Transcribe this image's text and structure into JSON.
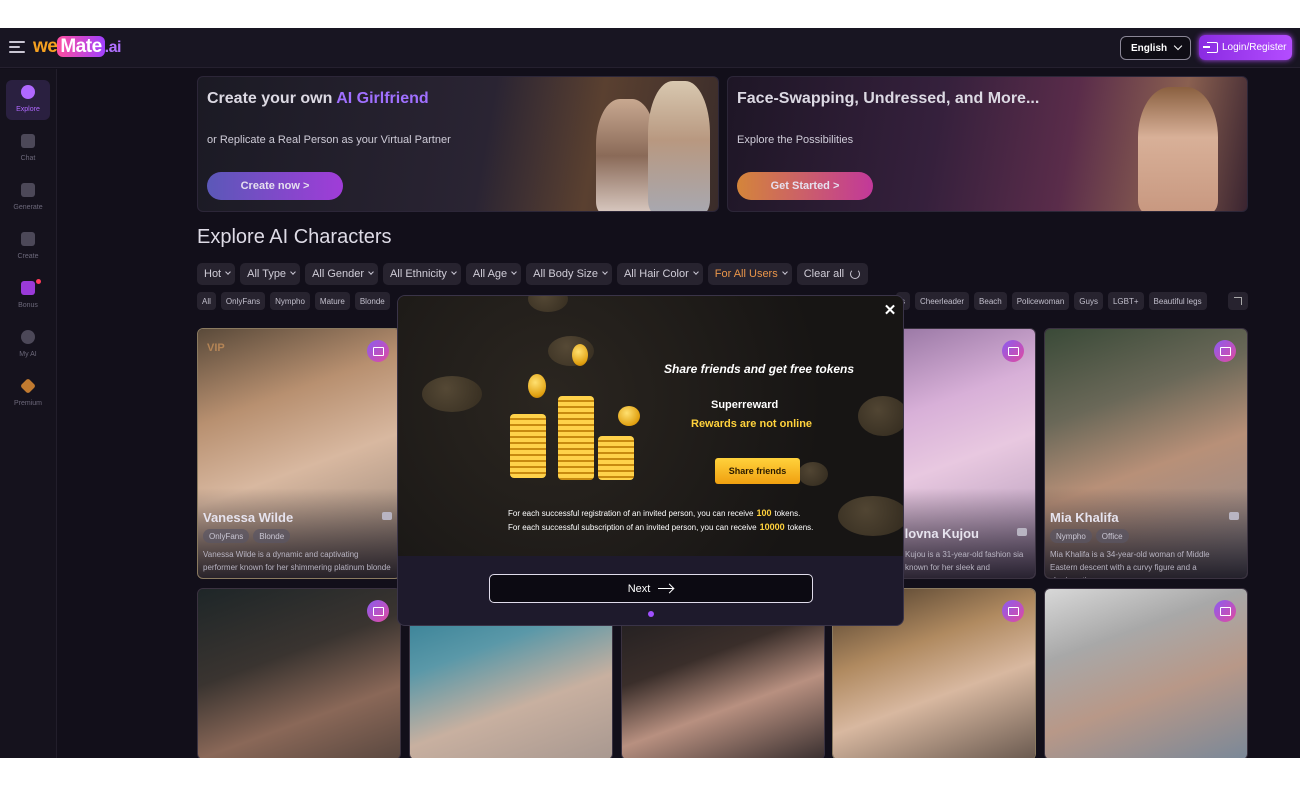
{
  "header": {
    "logo_we": "we",
    "logo_mate": "Mate",
    "logo_ai": ".ai",
    "language": "English",
    "login": "Login/Register"
  },
  "sidebar": {
    "items": [
      {
        "label": "Explore",
        "icon": "compass-icon"
      },
      {
        "label": "Chat",
        "icon": "chat-icon"
      },
      {
        "label": "Generate",
        "icon": "sparkle-icon"
      },
      {
        "label": "Create",
        "icon": "magic-wand-icon"
      },
      {
        "label": "Bonus",
        "icon": "gift-icon"
      },
      {
        "label": "My AI",
        "icon": "heart-icon"
      },
      {
        "label": "Premium",
        "icon": "diamond-icon"
      }
    ]
  },
  "banners": [
    {
      "title_prefix": "Create your own ",
      "title_accent": "AI Girlfriend",
      "subtitle": "or Replicate a Real Person as your Virtual Partner",
      "button": "Create now >"
    },
    {
      "title": "Face-Swapping, Undressed, and More...",
      "subtitle": "Explore the Possibilities",
      "button": "Get Started >"
    }
  ],
  "explore": {
    "title": "Explore AI Characters",
    "filters": [
      "Hot",
      "All Type",
      "All Gender",
      "All Ethnicity",
      "All Age",
      "All Body Size",
      "All Hair Color",
      "For All Users"
    ],
    "clear_all": "Clear all",
    "tags_left": [
      "All",
      "OnlyFans",
      "Nympho",
      "Mature",
      "Blonde"
    ],
    "tags_right": [
      "s",
      "Cheerleader",
      "Beach",
      "Policewoman",
      "Guys",
      "LGBT+",
      "Beautiful legs"
    ]
  },
  "cards": [
    {
      "name": "Vanessa Wilde",
      "tags": [
        "OnlyFans",
        "Blonde"
      ],
      "desc": "Vanessa Wilde is a dynamic and captivating performer known for her shimmering platinum blonde",
      "vip": "VIP"
    },
    {
      "name": "ilovna Kujou",
      "tags": [],
      "desc": "Kujou is a 31-year-old fashion sia known for her sleek and"
    },
    {
      "name": "Mia Khalifa",
      "tags": [
        "Nympho",
        "Office"
      ],
      "desc": "Mia Khalifa is a 34-year-old woman of Middle Eastern descent with a curvy figure and a charismatic"
    }
  ],
  "modal": {
    "title": "Share friends and get free tokens",
    "superreward": "Superreward",
    "rewards_status": "Rewards are not online",
    "share_button": "Share friends",
    "line1_pre": "For each successful registration of an invited person, you can receive",
    "line1_amount": "100",
    "line1_post": "tokens.",
    "line2_pre": "For each successful subscription of an invited person, you can receive",
    "line2_amount": "10000",
    "line2_post": "tokens.",
    "next": "Next"
  },
  "colors": {
    "accent": "#a050ff",
    "brand_orange": "#f5a020",
    "reward_gold": "#ffd23c",
    "background": "#120f1a"
  }
}
